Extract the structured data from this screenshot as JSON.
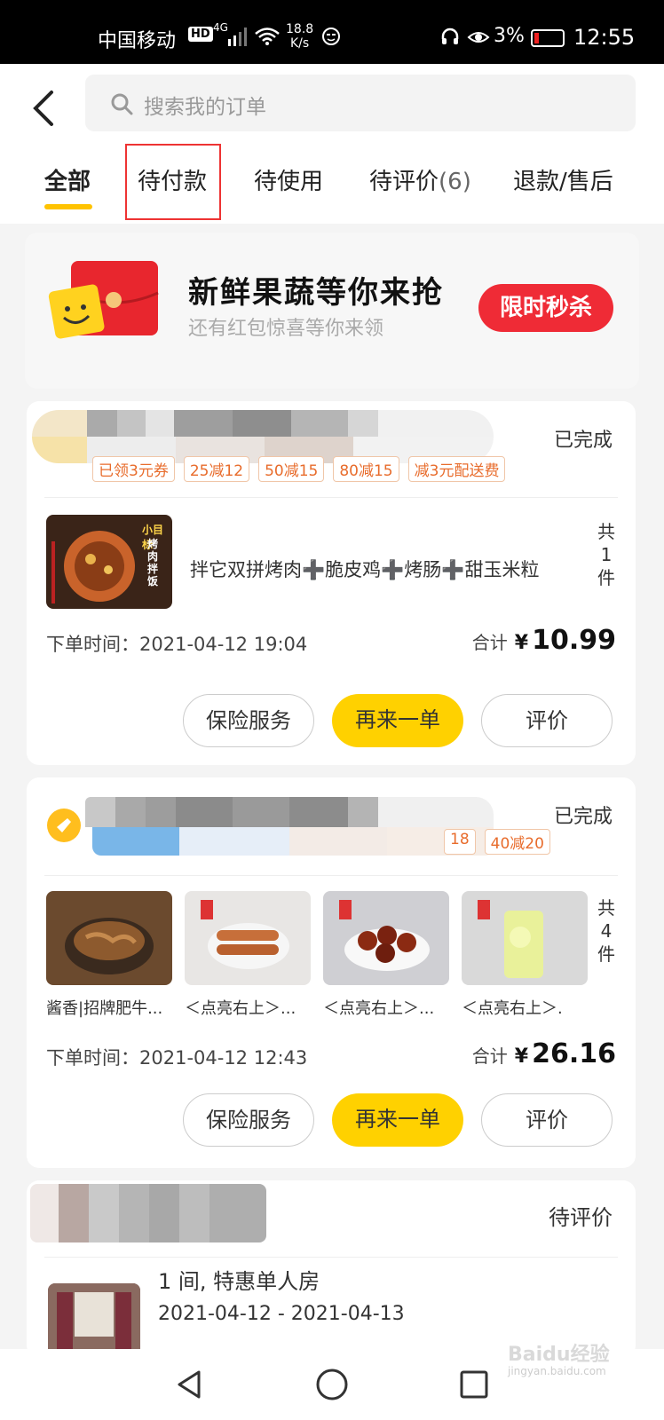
{
  "status_bar": {
    "carrier": "中国移动",
    "hd": "HD",
    "network": "4G",
    "speed_value": "18.8",
    "speed_unit": "K/s",
    "battery": "3%",
    "time": "12:55"
  },
  "search": {
    "placeholder": "搜索我的订单"
  },
  "tabs": [
    {
      "label": "全部",
      "count": ""
    },
    {
      "label": "待付款",
      "count": ""
    },
    {
      "label": "待使用",
      "count": ""
    },
    {
      "label": "待评价",
      "count": "(6)"
    },
    {
      "label": "退款/售后",
      "count": ""
    }
  ],
  "banner": {
    "title": "新鲜果蔬等你来抢",
    "subtitle": "还有红包惊喜等你来领",
    "button": "限时秒杀"
  },
  "orders": [
    {
      "status": "已完成",
      "tags": [
        "已领3元券",
        "25减12",
        "50减15",
        "80减15",
        "减3元配送费"
      ],
      "item_name": "拌它双拼烤肉➕脆皮鸡➕烤肠➕甜玉米粒",
      "thumb_labels": [
        "小目标",
        "烤肉拌饭"
      ],
      "count_label": [
        "共",
        "1",
        "件"
      ],
      "order_time_label": "下单时间：",
      "order_time": "2021-04-12 19:04",
      "total_label": "合计",
      "currency": "¥",
      "total": "10.99",
      "buttons": [
        "保险服务",
        "再来一单",
        "评价"
      ]
    },
    {
      "status": "已完成",
      "tags": [
        "18",
        "40减20"
      ],
      "item_captions": [
        "酱香|招牌肥牛...",
        "＜点亮右上＞...",
        "＜点亮右上＞...",
        "＜点亮右上＞."
      ],
      "count_label": [
        "共",
        "4",
        "件"
      ],
      "order_time_label": "下单时间：",
      "order_time": "2021-04-12 12:43",
      "total_label": "合计",
      "currency": "¥",
      "total": "26.16",
      "buttons": [
        "保险服务",
        "再来一单",
        "评价"
      ]
    },
    {
      "status": "待评价",
      "room": "1 间, 特惠单人房",
      "dates": "2021-04-12 - 2021-04-13"
    }
  ],
  "watermark": {
    "brand": "Baidu经验",
    "url": "jingyan.baidu.com"
  },
  "colors": {
    "accent": "#ffd100",
    "underline": "#ffc300",
    "flash_sale": "#ef2b36",
    "tag_text": "#e86c2c"
  }
}
